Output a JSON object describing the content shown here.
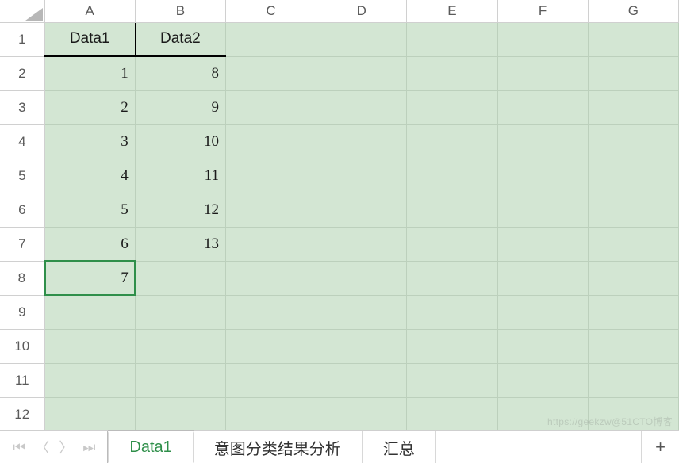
{
  "columns": [
    "A",
    "B",
    "C",
    "D",
    "E",
    "F",
    "G"
  ],
  "row_headers": [
    "1",
    "2",
    "3",
    "4",
    "5",
    "6",
    "7",
    "8",
    "9",
    "10",
    "11",
    "12"
  ],
  "table": {
    "headers": {
      "A": "Data1",
      "B": "Data2"
    },
    "rows": [
      {
        "A": "1",
        "B": "8"
      },
      {
        "A": "2",
        "B": "9"
      },
      {
        "A": "3",
        "B": "10"
      },
      {
        "A": "4",
        "B": "11"
      },
      {
        "A": "5",
        "B": "12"
      },
      {
        "A": "6",
        "B": "13"
      },
      {
        "A": "7",
        "B": ""
      }
    ]
  },
  "selected_cell": {
    "row": 8,
    "col": "A"
  },
  "tabs": {
    "items": [
      "Data1",
      "意图分类结果分析",
      "汇总"
    ],
    "active": "Data1"
  },
  "nav": {
    "first": "⎮‹",
    "prev": "‹",
    "next": "›",
    "last": "›⎮"
  },
  "add_tab_label": "+",
  "watermark": "https://geekzw@51CTO博客",
  "chart_data": {
    "type": "table",
    "title": "",
    "columns": [
      "Data1",
      "Data2"
    ],
    "rows": [
      [
        1,
        8
      ],
      [
        2,
        9
      ],
      [
        3,
        10
      ],
      [
        4,
        11
      ],
      [
        5,
        12
      ],
      [
        6,
        13
      ],
      [
        7,
        null
      ]
    ]
  }
}
